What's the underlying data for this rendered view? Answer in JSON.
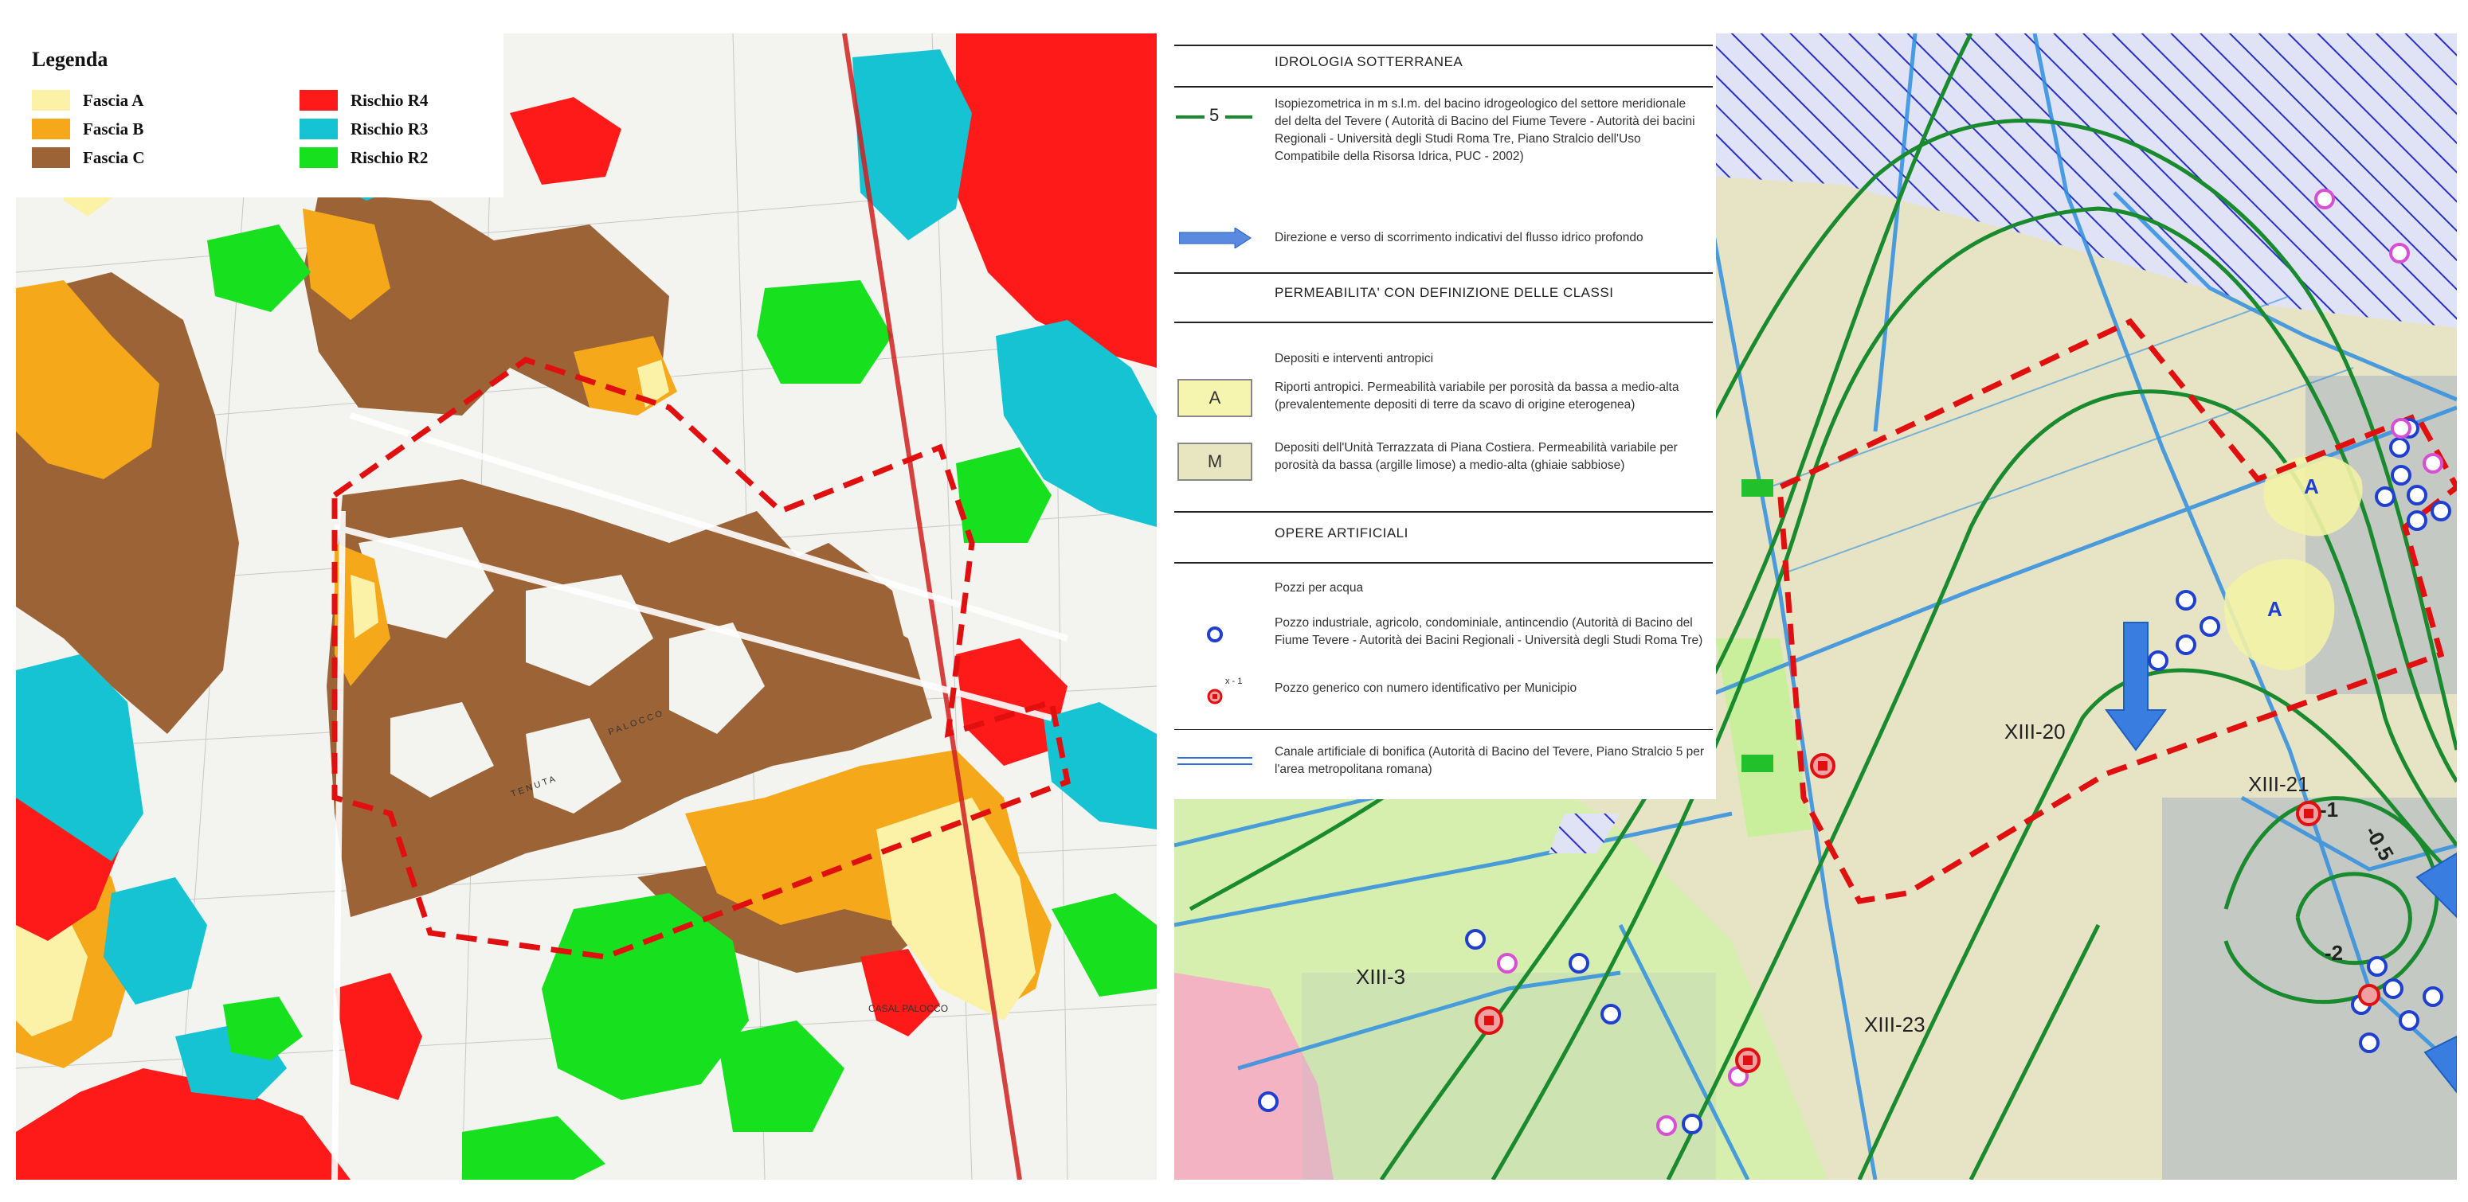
{
  "left_map": {
    "legend": {
      "title": "Legenda",
      "items": [
        {
          "label": "Fascia A",
          "color": "#fbf2a8"
        },
        {
          "label": "Fascia B",
          "color": "#f4a81a"
        },
        {
          "label": "Fascia C",
          "color": "#9c6336"
        },
        {
          "label": "Rischio R4",
          "color": "#ff1a1a"
        },
        {
          "label": "Rischio R3",
          "color": "#15c3d2"
        },
        {
          "label": "Rischio R2",
          "color": "#17e01f"
        }
      ]
    },
    "labels": {
      "casal_palocco": "CASAL PALOCCO",
      "palocco": "PALOCCO",
      "tenuta": "TENUTA"
    }
  },
  "right_map": {
    "legend": {
      "section_groundwater": "IDROLOGIA SOTTERRANEA",
      "contour_symbol": "5",
      "contour_text": "Isopiezometrica in m s.l.m. del bacino idrogeologico del settore meridionale del delta del Tevere ( Autorità di Bacino del Fiume Tevere - Autorità dei bacini Regionali - Università degli Studi Roma Tre, Piano Stralcio dell'Uso Compatibile della Risorsa Idrica, PUC - 2002)",
      "flow_text": "Direzione e verso di scorrimento indicativi del flusso idrico profondo",
      "section_permeability": "PERMEABILITA' CON DEFINIZIONE DELLE CLASSI",
      "anthropic_heading": "Depositi e interventi antropici",
      "class_a_symbol": "A",
      "class_a_text": "Riporti antropici. Permeabilità variabile per porosità da bassa a medio-alta (prevalentemente depositi di terre da scavo di origine eterogenea)",
      "class_m_symbol": "M",
      "class_m_text": "Depositi dell'Unità Terrazzata di Piana Costiera. Permeabilità variabile per porosità da bassa (argille limose) a medio-alta (ghiaie sabbiose)",
      "section_works": "OPERE ARTIFICIALI",
      "wells_heading": "Pozzi per acqua",
      "well_industrial_text": "Pozzo industriale, agricolo, condominiale, antincendio (Autorità di Bacino del Fiume Tevere - Autorità dei Bacini Regionali - Università degli Studi Roma Tre)",
      "well_generic_symbol": "x - 1",
      "well_generic_text": "Pozzo generico con numero identificativo per Municipio",
      "canal_text": "Canale artificiale di bonifica (Autorità di Bacino del Tevere, Piano Stralcio 5 per l'area metropolitana romana)"
    },
    "well_labels": {
      "xiii_3": "XIII-3",
      "xiii_20": "XIII-20",
      "xiii_21": "XIII-21",
      "xiii_23": "XIII-23"
    },
    "contour_labels": {
      "c1": "-1",
      "c05": "-0.5",
      "c2": "-2"
    },
    "zone_labels": [
      "A",
      "A"
    ]
  }
}
